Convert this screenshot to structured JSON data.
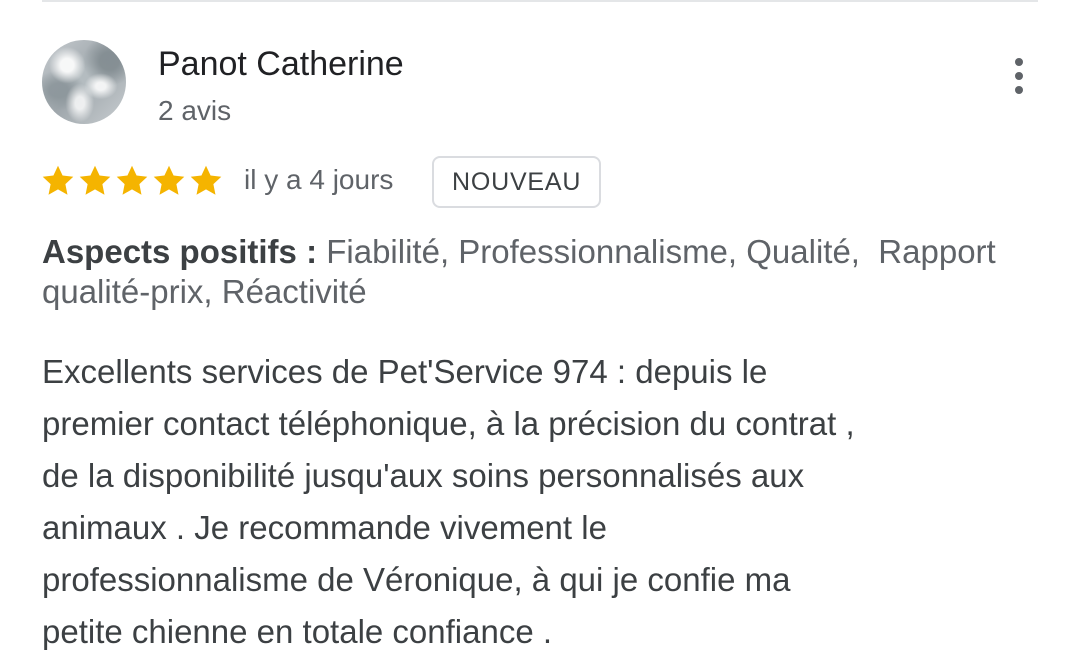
{
  "review": {
    "author_name": "Panot Catherine",
    "review_count": "2 avis",
    "more_options_icon": "more-vert-icon",
    "rating": 5,
    "rating_max": 5,
    "star_icon": "star-icon",
    "star_color": "#f5b400",
    "timestamp": "il y a 4 jours",
    "badge": "NOUVEAU",
    "aspects_label": "Aspects positifs :",
    "aspects_values": "Fiabilité, Professionnalisme, Qualité,  Rapport qualité-prix, Réactivité",
    "text": "Excellents services de Pet'Service 974  :  depuis le\npremier contact téléphonique,  à la précision du contrat ,\n de la disponibilité jusqu'aux soins personnalisés aux\nanimaux . Je recommande vivement le\nprofessionnalisme de Véronique,  à qui je confie ma\npetite chienne en totale confiance ."
  }
}
